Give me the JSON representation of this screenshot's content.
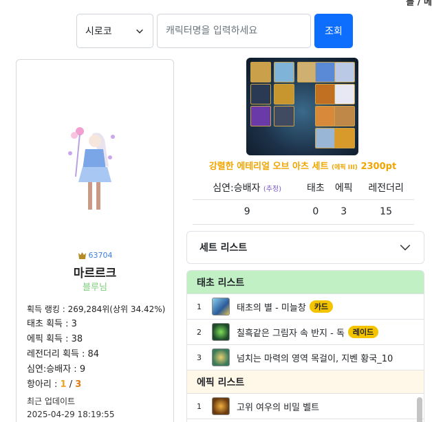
{
  "topnav": {
    "text": "를 / 메"
  },
  "search": {
    "server": "시로코",
    "placeholder": "캐릭터명을 입력하세요",
    "button": "조회"
  },
  "profile": {
    "rank_score": "63704",
    "name": "마르르크",
    "class": "블루님",
    "stats": {
      "acquire_rank": "획득 랭킹 : 269,284위(상위 34.42%)",
      "taecho": "태초 획득 : 3",
      "epic": "에픽 획득 : 38",
      "legendary": "레전더리 획득 : 84",
      "abyss": "심연:승배자 : 9",
      "pet_label": "항아리 : ",
      "pet_current": "1",
      "pet_sep": " / ",
      "pet_max": "3"
    },
    "updated_label": "최근 업데이트",
    "updated_time": "2025-04-29 18:19:55"
  },
  "set": {
    "title": "강렬한 에테리얼 오브 아츠 세트",
    "tag": "(에픽 III)",
    "points": "2300pt"
  },
  "counts": {
    "headers": [
      "심연:승배자",
      "(추정)",
      "태초",
      "에픽",
      "레전더리"
    ],
    "values": [
      "9",
      "0",
      "3",
      "15"
    ]
  },
  "set_list": {
    "label": "세트 리스트"
  },
  "groups": {
    "taecho": {
      "label": "태초 리스트",
      "items": [
        {
          "num": "1",
          "name": "태초의 별 - 미늘창",
          "badge": "카드"
        },
        {
          "num": "2",
          "name": "칠흑같은 그림자 속 반지 - 독",
          "badge": "레이드"
        },
        {
          "num": "3",
          "name": "넘치는 마력의 영역 목걸이, 지벤 황국_10",
          "badge": ""
        }
      ]
    },
    "epic": {
      "label": "에픽 리스트",
      "items": [
        {
          "num": "1",
          "name": "고위 여우의 비밀 벨트",
          "badge": ""
        }
      ]
    }
  },
  "colors": {
    "accent": "#0d6efd",
    "set_title": "#f0a500",
    "taecho_bg": "#c2f0c5",
    "epic_bg": "#fff8e8"
  }
}
